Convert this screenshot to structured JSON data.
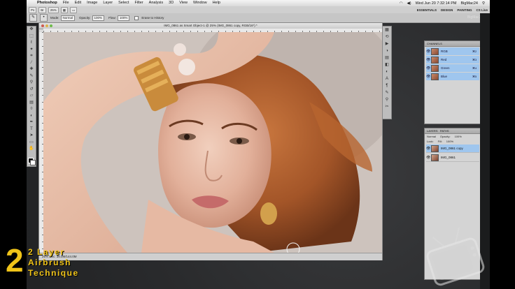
{
  "menubar": {
    "app": "Photoshop",
    "items": [
      "File",
      "Edit",
      "Image",
      "Layer",
      "Select",
      "Filter",
      "Analysis",
      "3D",
      "View",
      "Window",
      "Help"
    ],
    "clock": "Wed Jun 20  7:32:14 PM",
    "user": "BigMac24"
  },
  "appbar": {
    "zoom": "25%",
    "workspaces": [
      "ESSENTIALS",
      "DESIGN",
      "PAINTING"
    ],
    "cs_live": "CS Live"
  },
  "options": {
    "mode_label": "Mode:",
    "mode_value": "Normal",
    "opacity_label": "Opacity:",
    "opacity_value": "100%",
    "flow_label": "Flow:",
    "flow_value": "100%",
    "erase_history": "Erase to History"
  },
  "document": {
    "title": "IMG_0861 as Smart Object-1 @ 25% (IMG_0861 copy, RGB/16*) *",
    "status": "25%   Doc: 36.0M/144.0M"
  },
  "side_label": "BigMac24",
  "channels": {
    "header": "CHANNELS",
    "rows": [
      {
        "name": "RGB",
        "shortcut": "⌘2"
      },
      {
        "name": "Red",
        "shortcut": "⌘3"
      },
      {
        "name": "Green",
        "shortcut": "⌘4"
      },
      {
        "name": "Blue",
        "shortcut": "⌘5"
      }
    ]
  },
  "layers": {
    "tabs": [
      "LAYERS",
      "PATHS"
    ],
    "blend": "Normal",
    "opacity_label": "Opacity:",
    "opacity_value": "100%",
    "lock_label": "Lock:",
    "fill_label": "Fill:",
    "fill_value": "100%",
    "rows": [
      {
        "name": "IMG_0861 copy"
      },
      {
        "name": "IMG_0861"
      }
    ]
  },
  "overlay": {
    "number": "2",
    "line1": "Layer",
    "line2": "Airbrush",
    "line3": "Technique"
  },
  "colors": {
    "overlay_text": "#f0c419",
    "selection": "#9fc6ee"
  }
}
